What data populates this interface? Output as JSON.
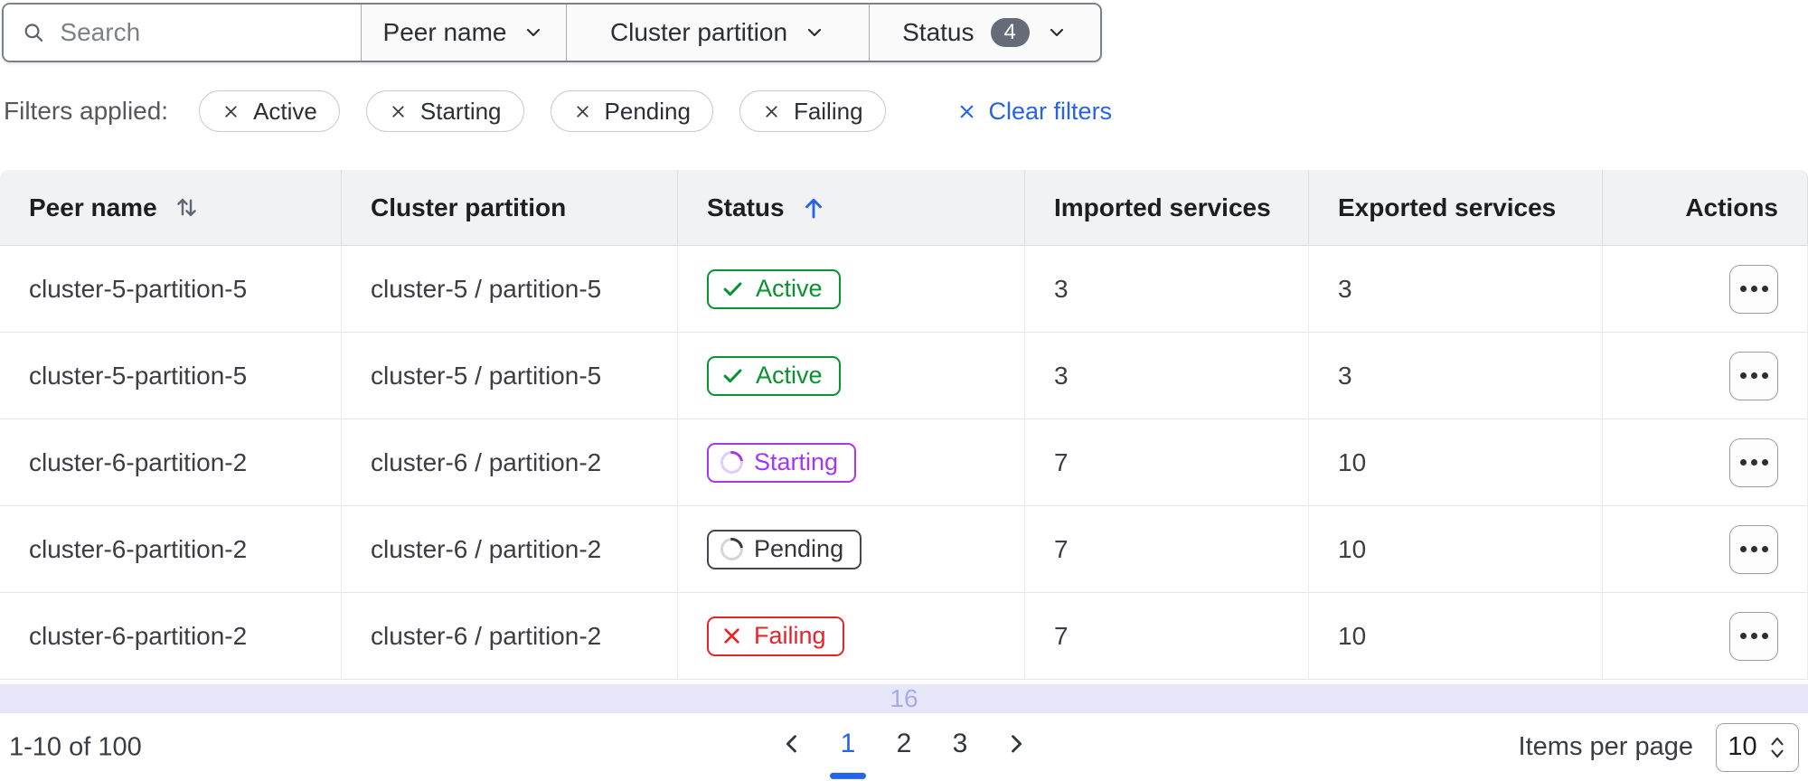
{
  "toolbar": {
    "search": {
      "placeholder": "Search"
    },
    "dropdowns": [
      {
        "label": "Peer name"
      },
      {
        "label": "Cluster partition"
      },
      {
        "label": "Status",
        "badge": "4"
      }
    ]
  },
  "filters": {
    "label": "Filters applied:",
    "chips": [
      {
        "label": "Active"
      },
      {
        "label": "Starting"
      },
      {
        "label": "Pending"
      },
      {
        "label": "Failing"
      }
    ],
    "clear_label": "Clear filters"
  },
  "table": {
    "columns": [
      {
        "label": "Peer name",
        "sort": "sortable"
      },
      {
        "label": "Cluster partition",
        "sort": "none"
      },
      {
        "label": "Status",
        "sort": "ascending"
      },
      {
        "label": "Imported services",
        "sort": "none"
      },
      {
        "label": "Exported services",
        "sort": "none"
      },
      {
        "label": "Actions",
        "sort": "none"
      }
    ],
    "rows": [
      {
        "peer": "cluster-5-partition-5",
        "partition": "cluster-5 / partition-5",
        "status": "Active",
        "imported": "3",
        "exported": "3"
      },
      {
        "peer": "cluster-5-partition-5",
        "partition": "cluster-5 / partition-5",
        "status": "Active",
        "imported": "3",
        "exported": "3"
      },
      {
        "peer": "cluster-6-partition-2",
        "partition": "cluster-6 / partition-2",
        "status": "Starting",
        "imported": "7",
        "exported": "10"
      },
      {
        "peer": "cluster-6-partition-2",
        "partition": "cluster-6 / partition-2",
        "status": "Pending",
        "imported": "7",
        "exported": "10"
      },
      {
        "peer": "cluster-6-partition-2",
        "partition": "cluster-6 / partition-2",
        "status": "Failing",
        "imported": "7",
        "exported": "10"
      }
    ],
    "overflow_indicator": "16"
  },
  "pagination": {
    "range_text": "1-10 of 100",
    "pages": [
      "1",
      "2",
      "3"
    ],
    "current_page": "1",
    "items_per_page_label": "Items per page",
    "items_per_page_value": "10"
  },
  "colors": {
    "accent_blue": "#2563eb",
    "status_active_green": "#08932e",
    "status_starting_purple": "#a437f0",
    "status_pending_gray": "#45484f",
    "status_failing_red": "#e5242a",
    "header_bg": "#f1f2f4",
    "overflow_strip_bg": "#e6e6f8",
    "count_badge_bg": "#656c78"
  }
}
